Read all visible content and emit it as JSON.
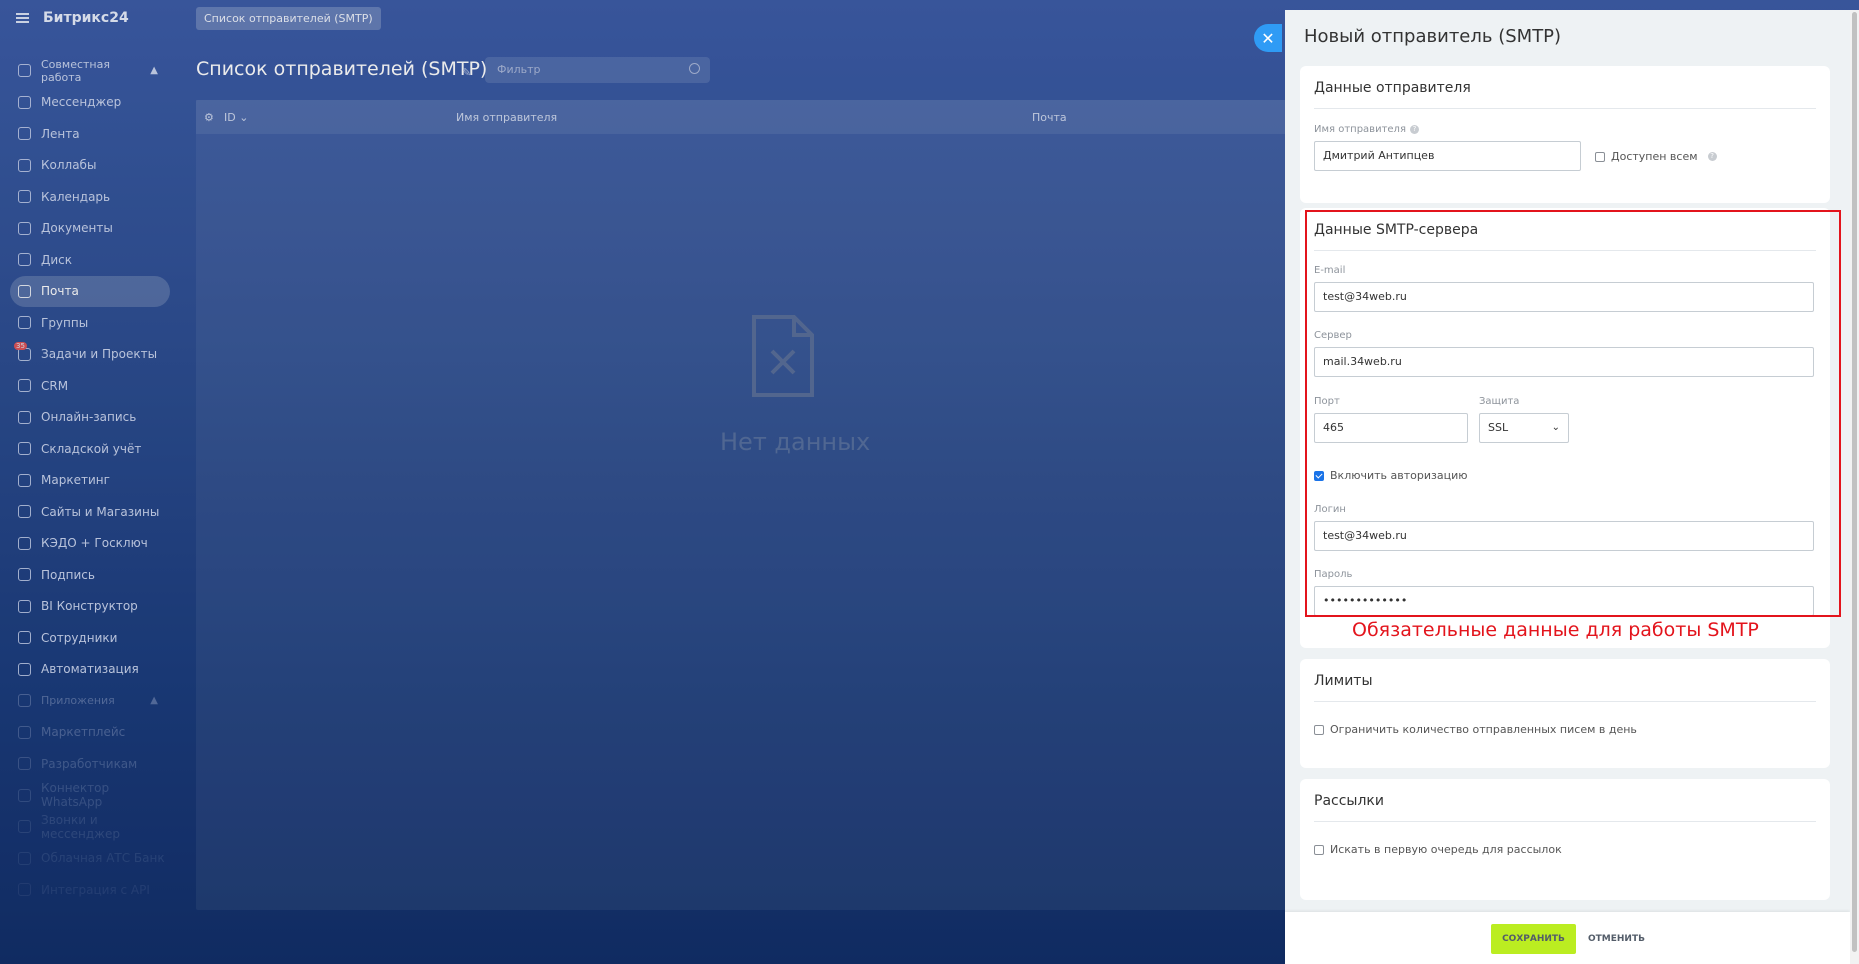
{
  "sidebar": {
    "logo": "Битрикс24",
    "sections": {
      "collab": "Совместная работа",
      "apps": "Приложения"
    },
    "items": [
      {
        "label": "Мессенджер",
        "icon": "chat-icon"
      },
      {
        "label": "Лента",
        "icon": "feed-icon"
      },
      {
        "label": "Коллабы",
        "icon": "collab-icon"
      },
      {
        "label": "Календарь",
        "icon": "calendar-icon"
      },
      {
        "label": "Документы",
        "icon": "document-icon"
      },
      {
        "label": "Диск",
        "icon": "disk-icon"
      },
      {
        "label": "Почта",
        "icon": "mail-icon"
      },
      {
        "label": "Группы",
        "icon": "groups-icon"
      },
      {
        "label": "Задачи и Проекты",
        "icon": "tasks-icon",
        "badge": "35"
      },
      {
        "label": "CRM",
        "icon": "crm-icon"
      },
      {
        "label": "Онлайн-запись",
        "icon": "booking-icon"
      },
      {
        "label": "Складской учёт",
        "icon": "warehouse-icon"
      },
      {
        "label": "Маркетинг",
        "icon": "marketing-icon"
      },
      {
        "label": "Сайты и Магазины",
        "icon": "shop-icon"
      },
      {
        "label": "КЭДО + Госключ",
        "icon": "kedo-icon"
      },
      {
        "label": "Подпись",
        "icon": "signature-icon"
      },
      {
        "label": "BI Конструктор",
        "icon": "bi-icon"
      },
      {
        "label": "Сотрудники",
        "icon": "employees-icon"
      },
      {
        "label": "Автоматизация",
        "icon": "automation-icon"
      }
    ],
    "apps_items": [
      {
        "label": "Маркетплейс"
      },
      {
        "label": "Разработчикам"
      },
      {
        "label": "Коннектор WhatsApp"
      },
      {
        "label": "Звонки и мессенджер"
      },
      {
        "label": "Облачная АТС Банк"
      },
      {
        "label": "Интеграция с API"
      }
    ]
  },
  "main": {
    "breadcrumb": "Список отправителей (SMTP)",
    "title": "Список отправителей (SMTP)",
    "filter_placeholder": "Фильтр",
    "columns": [
      "ID",
      "Имя отправителя",
      "Почта"
    ],
    "empty_text": "Нет данных"
  },
  "slider": {
    "title": "Новый отправитель (SMTP)",
    "sender": {
      "section_title": "Данные отправителя",
      "name_label": "Имя отправителя",
      "name_value": "Дмитрий Антипцев",
      "public_label": "Доступен всем"
    },
    "smtp": {
      "section_title": "Данные SMTP-сервера",
      "email_label": "E-mail",
      "email_value": "test@34web.ru",
      "server_label": "Сервер",
      "server_value": "mail.34web.ru",
      "port_label": "Порт",
      "port_value": "465",
      "security_label": "Защита",
      "security_value": "SSL",
      "auth_label": "Включить авторизацию",
      "auth_checked": true,
      "login_label": "Логин",
      "login_value": "test@34web.ru",
      "password_label": "Пароль",
      "password_value": "•••••••••••••"
    },
    "annotation": "Обязательные данные для работы SMTP",
    "limits": {
      "section_title": "Лимиты",
      "limit_label": "Ограничить количество отправленных писем в день"
    },
    "mailings": {
      "section_title": "Рассылки",
      "mailing_label": "Искать в первую очередь для рассылок"
    },
    "save": "СОХРАНИТЬ",
    "cancel": "ОТМЕНИТЬ"
  },
  "colors": {
    "accent_red": "#e3141c",
    "save_green": "#bbed21",
    "close_blue": "#2f9bf5"
  }
}
